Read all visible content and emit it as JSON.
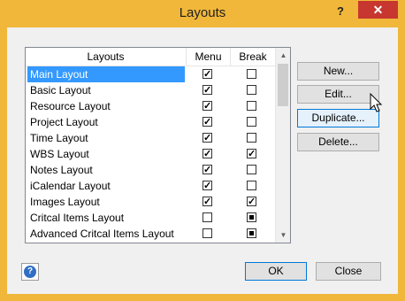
{
  "window": {
    "title": "Layouts",
    "help_glyph": "?",
    "close_glyph": "✕"
  },
  "list": {
    "headers": {
      "name": "Layouts",
      "menu": "Menu",
      "break": "Break"
    },
    "rows": [
      {
        "name": "Main Layout",
        "menu": true,
        "break": "unchecked",
        "selected": true
      },
      {
        "name": "Basic Layout",
        "menu": true,
        "break": "unchecked"
      },
      {
        "name": "Resource Layout",
        "menu": true,
        "break": "unchecked"
      },
      {
        "name": "Project Layout",
        "menu": true,
        "break": "unchecked"
      },
      {
        "name": "Time Layout",
        "menu": true,
        "break": "unchecked"
      },
      {
        "name": "WBS Layout",
        "menu": true,
        "break": "checked"
      },
      {
        "name": "Notes Layout",
        "menu": true,
        "break": "unchecked"
      },
      {
        "name": "iCalendar Layout",
        "menu": true,
        "break": "unchecked"
      },
      {
        "name": "Images Layout",
        "menu": true,
        "break": "checked"
      },
      {
        "name": "Critcal Items Layout",
        "menu": false,
        "break": "indeterminate"
      },
      {
        "name": "Advanced Critcal Items Layout",
        "menu": false,
        "break": "indeterminate"
      }
    ]
  },
  "buttons": {
    "new": "New...",
    "edit": "Edit...",
    "duplicate": "Duplicate...",
    "delete": "Delete...",
    "ok": "OK",
    "close": "Close"
  },
  "colors": {
    "titlebar": "#f0b73a",
    "close_button": "#c7372f",
    "selection": "#3399ff",
    "help_icon": "#2f6fc4"
  }
}
